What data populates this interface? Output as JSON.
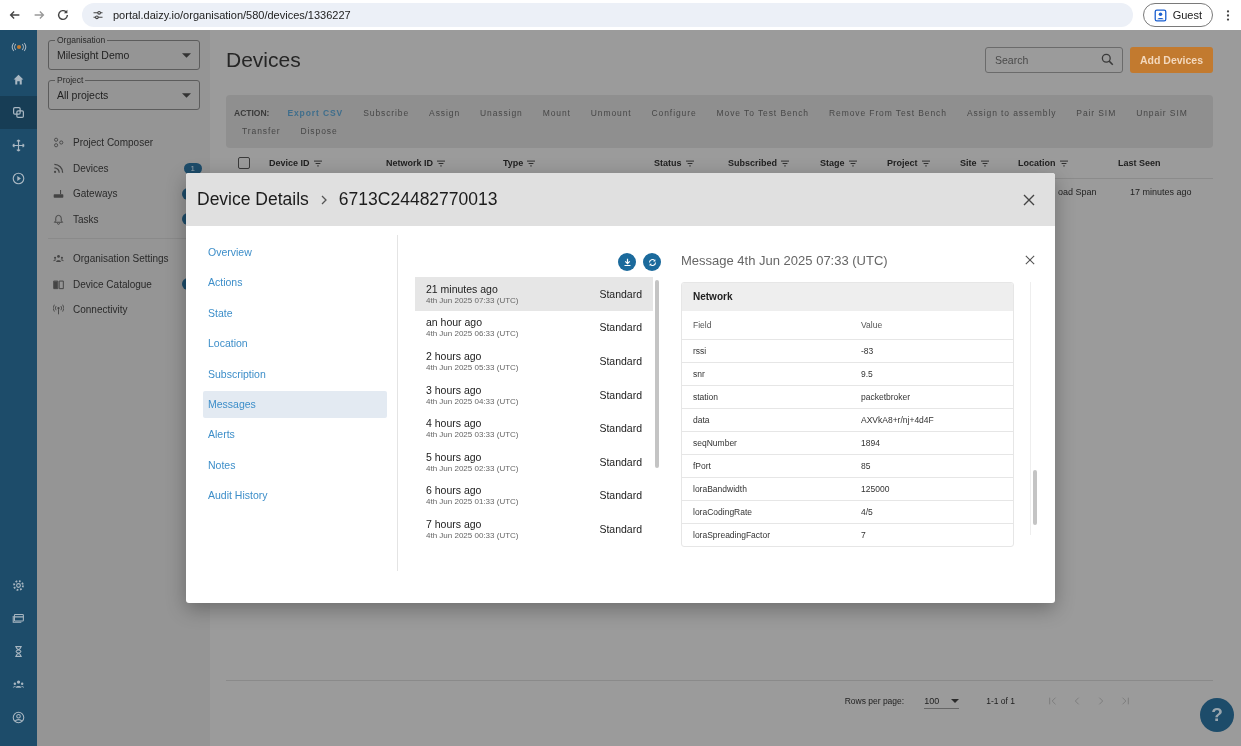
{
  "browser": {
    "url": "portal.daizy.io/organisation/580/devices/1336227",
    "profile": "Guest"
  },
  "rail": {
    "top": [
      {
        "kind": "logo",
        "selected": false
      },
      {
        "kind": "home",
        "selected": false
      },
      {
        "kind": "devices",
        "selected": true
      },
      {
        "kind": "network",
        "selected": false
      },
      {
        "kind": "play",
        "selected": false
      }
    ],
    "bottom": [
      {
        "kind": "settings",
        "selected": false
      },
      {
        "kind": "billing",
        "selected": false
      },
      {
        "kind": "hourglass",
        "selected": false
      },
      {
        "kind": "people",
        "selected": false
      },
      {
        "kind": "account",
        "selected": false
      }
    ]
  },
  "sidebar": {
    "organisation": {
      "label": "Organisation",
      "value": "Milesight Demo"
    },
    "project": {
      "label": "Project",
      "value": "All projects"
    },
    "groups": [
      [
        {
          "kind": "composer",
          "label": "Project Composer"
        },
        {
          "kind": "feed",
          "label": "Devices",
          "badge": "1"
        },
        {
          "kind": "router",
          "label": "Gateways",
          "badge_dot": true
        },
        {
          "kind": "bell",
          "label": "Tasks",
          "badge_dot": true
        }
      ],
      [
        {
          "kind": "people",
          "label": "Organisation Settings"
        },
        {
          "kind": "book",
          "label": "Device Catalogue",
          "badge_dot": true
        },
        {
          "kind": "antenna",
          "label": "Connectivity"
        }
      ]
    ]
  },
  "page": {
    "title": "Devices",
    "search": {
      "placeholder": "Search"
    },
    "add_button": "Add Devices",
    "action_label": "ACTION:",
    "actions": [
      {
        "label": "Export CSV",
        "disabled": false
      },
      {
        "label": "Subscribe",
        "disabled": true
      },
      {
        "label": "Assign",
        "disabled": true
      },
      {
        "label": "Unassign",
        "disabled": true
      },
      {
        "label": "Mount",
        "disabled": true
      },
      {
        "label": "Unmount",
        "disabled": true
      },
      {
        "label": "Configure",
        "disabled": true
      },
      {
        "label": "Move To Test Bench",
        "disabled": true
      },
      {
        "label": "Remove From Test Bench",
        "disabled": true
      },
      {
        "label": "Assign to assembly",
        "disabled": true
      },
      {
        "label": "Pair SIM",
        "disabled": true
      },
      {
        "label": "Unpair SIM",
        "disabled": true
      },
      {
        "label": "Transfer",
        "disabled": true
      },
      {
        "label": "Dispose",
        "disabled": true
      }
    ],
    "table": {
      "select_all": {
        "checked": false
      },
      "columns": [
        {
          "label": "Device ID",
          "filter": true
        },
        {
          "label": "Network ID",
          "filter": true
        },
        {
          "label": "Type",
          "filter": true
        },
        {
          "label": "Status",
          "filter": true
        },
        {
          "label": "Subscribed",
          "filter": true
        },
        {
          "label": "Stage",
          "filter": true
        },
        {
          "label": "Project",
          "filter": true
        },
        {
          "label": "Site",
          "filter": true
        },
        {
          "label": "Location",
          "filter": true
        },
        {
          "label": "Last Seen",
          "filter": false
        }
      ],
      "rows": [
        {
          "location": "oad Span",
          "last_seen": "17 minutes ago"
        }
      ]
    },
    "pagination": {
      "rows_label": "Rows per page:",
      "rows_value": "100",
      "range": "1-1 of 1"
    }
  },
  "help": "?",
  "modal": {
    "title": "Device Details",
    "device_id": "6713C24482770013",
    "nav": [
      {
        "label": "Overview",
        "selected": false
      },
      {
        "label": "Actions",
        "selected": false
      },
      {
        "label": "State",
        "selected": false
      },
      {
        "label": "Location",
        "selected": false
      },
      {
        "label": "Subscription",
        "selected": false
      },
      {
        "label": "Messages",
        "selected": true
      },
      {
        "label": "Alerts",
        "selected": false
      },
      {
        "label": "Notes",
        "selected": false
      },
      {
        "label": "Audit History",
        "selected": false
      }
    ],
    "messages": [
      {
        "relative": "21 minutes ago",
        "timestamp": "4th Jun 2025 07:33 (UTC)",
        "type": "Standard",
        "selected": true
      },
      {
        "relative": "an hour ago",
        "timestamp": "4th Jun 2025 06:33 (UTC)",
        "type": "Standard",
        "selected": false
      },
      {
        "relative": "2 hours ago",
        "timestamp": "4th Jun 2025 05:33 (UTC)",
        "type": "Standard",
        "selected": false
      },
      {
        "relative": "3 hours ago",
        "timestamp": "4th Jun 2025 04:33 (UTC)",
        "type": "Standard",
        "selected": false
      },
      {
        "relative": "4 hours ago",
        "timestamp": "4th Jun 2025 03:33 (UTC)",
        "type": "Standard",
        "selected": false
      },
      {
        "relative": "5 hours ago",
        "timestamp": "4th Jun 2025 02:33 (UTC)",
        "type": "Standard",
        "selected": false
      },
      {
        "relative": "6 hours ago",
        "timestamp": "4th Jun 2025 01:33 (UTC)",
        "type": "Standard",
        "selected": false
      },
      {
        "relative": "7 hours ago",
        "timestamp": "4th Jun 2025 00:33 (UTC)",
        "type": "Standard",
        "selected": false
      }
    ],
    "detail": {
      "title": "Message 4th Jun 2025 07:33 (UTC)",
      "section": "Network",
      "columns": [
        "Field",
        "Value"
      ],
      "rows": [
        [
          "rssi",
          "-83"
        ],
        [
          "snr",
          "9.5"
        ],
        [
          "station",
          "packetbroker"
        ],
        [
          "data",
          "AXVkA8+r/nj+4d4F"
        ],
        [
          "seqNumber",
          "1894"
        ],
        [
          "fPort",
          "85"
        ],
        [
          "loraBandwidth",
          "125000"
        ],
        [
          "loraCodingRate",
          "4/5"
        ],
        [
          "loraSpreadingFactor",
          "7"
        ]
      ]
    }
  }
}
